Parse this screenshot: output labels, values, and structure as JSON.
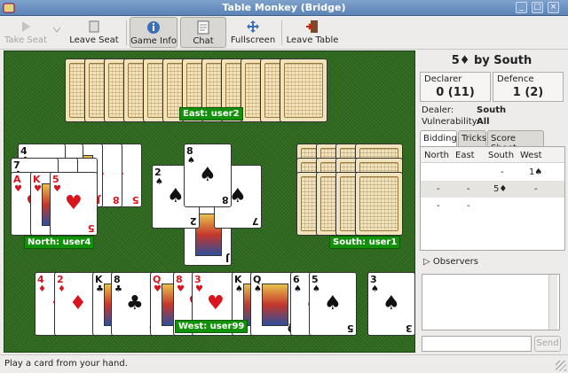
{
  "window": {
    "title": "Table Monkey (Bridge)",
    "controls": [
      "_",
      "□",
      "×"
    ]
  },
  "toolbar": {
    "take_seat": "Take Seat",
    "leave_seat": "Leave Seat",
    "game_info": "Game Info",
    "chat": "Chat",
    "fullscreen": "Fullscreen",
    "leave_table": "Leave Table"
  },
  "seats": {
    "east": "East: user2",
    "north": "North: user4",
    "south": "South: user1",
    "west": "West: user99"
  },
  "hands": {
    "north_visible": [
      {
        "rank": "A",
        "suit": "♥",
        "color": "red"
      },
      {
        "rank": "K",
        "suit": "♥",
        "color": "red"
      },
      {
        "rank": "5",
        "suit": "♥",
        "color": "red"
      },
      {
        "rank": "9",
        "suit": "♣",
        "color": "blk"
      },
      {
        "rank": "7",
        "suit": "♣",
        "color": "blk"
      },
      {
        "rank": "6",
        "suit": "♣",
        "color": "blk"
      },
      {
        "rank": "5",
        "suit": "♣",
        "color": "blk"
      },
      {
        "rank": "9",
        "suit": "♦",
        "color": "red"
      },
      {
        "rank": "J",
        "suit": "♦",
        "color": "red"
      },
      {
        "rank": "8",
        "suit": "♦",
        "color": "red"
      },
      {
        "rank": "5",
        "suit": "♦",
        "color": "red"
      },
      {
        "rank": "4",
        "suit": "♣",
        "color": "blk"
      }
    ],
    "west": [
      {
        "rank": "4",
        "suit": "♦",
        "color": "red"
      },
      {
        "rank": "2",
        "suit": "♦",
        "color": "red"
      },
      {
        "rank": "K",
        "suit": "♣",
        "color": "blk"
      },
      {
        "rank": "8",
        "suit": "♣",
        "color": "blk"
      },
      {
        "rank": "Q",
        "suit": "♥",
        "color": "red"
      },
      {
        "rank": "8",
        "suit": "♥",
        "color": "red"
      },
      {
        "rank": "3",
        "suit": "♥",
        "color": "red"
      },
      {
        "rank": "K",
        "suit": "♠",
        "color": "blk"
      },
      {
        "rank": "Q",
        "suit": "♠",
        "color": "blk"
      },
      {
        "rank": "6",
        "suit": "♠",
        "color": "blk"
      },
      {
        "rank": "5",
        "suit": "♠",
        "color": "blk"
      },
      {
        "rank": "3",
        "suit": "♠",
        "color": "blk"
      }
    ],
    "trick": [
      {
        "rank": "2",
        "suit": "♠",
        "color": "blk"
      },
      {
        "rank": "8",
        "suit": "♠",
        "color": "blk"
      },
      {
        "rank": "7",
        "suit": "♠",
        "color": "blk"
      },
      {
        "rank": "J",
        "suit": "♠",
        "color": "blk"
      }
    ]
  },
  "contract": "5♦ by South",
  "declarer": {
    "label": "Declarer",
    "value": "0 (11)"
  },
  "defence": {
    "label": "Defence",
    "value": "1 (2)"
  },
  "dealer": {
    "label": "Dealer:",
    "value": "South"
  },
  "vulnerability": {
    "label": "Vulnerability:",
    "value": "All"
  },
  "tabs": [
    "Bidding",
    "Tricks",
    "Score Sheet"
  ],
  "bidding": {
    "columns": [
      "North",
      "East",
      "South",
      "West"
    ],
    "rows": [
      [
        "",
        "",
        "-",
        "1♠"
      ],
      [
        "-",
        "-",
        "5♦",
        "-"
      ],
      [
        "-",
        "-",
        "",
        ""
      ]
    ]
  },
  "observers": "Observers",
  "chat": {
    "send": "Send",
    "input": ""
  },
  "status": "Play a card from your hand."
}
